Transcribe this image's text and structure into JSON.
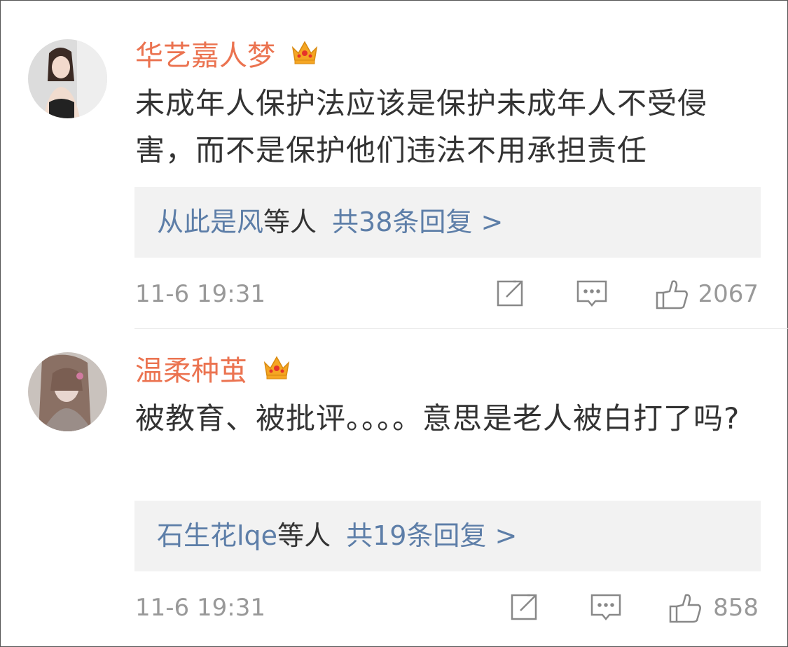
{
  "comments": [
    {
      "username": "华艺嘉人梦",
      "text": "未成年人保护法应该是保护未成年人不受侵害，而不是保护他们违法不用承担责任",
      "replies": {
        "names": "从此是风",
        "suffix": "等人",
        "count": "共38条回复 >"
      },
      "time": "11-6 19:31",
      "likes": "2067",
      "icons": {
        "badge": "crown-icon",
        "share": "share-icon",
        "reply": "comment-icon",
        "like": "thumbs-up-icon"
      }
    },
    {
      "username": "温柔种茧",
      "text": "被教育、被批评。。。。意思是老人被白打了吗?",
      "replies": {
        "names": "石生花lqe",
        "suffix": "等人",
        "count": "共19条回复 >"
      },
      "time": "11-6 19:31",
      "likes": "858",
      "icons": {
        "badge": "crown-icon",
        "share": "share-icon",
        "reply": "comment-icon",
        "like": "thumbs-up-icon"
      }
    }
  ],
  "colors": {
    "username": "#eb7350",
    "link": "#5d7ea8",
    "text": "#333333",
    "meta": "#999999",
    "reply_bg": "#f2f2f2",
    "crown": "#f5a623"
  }
}
